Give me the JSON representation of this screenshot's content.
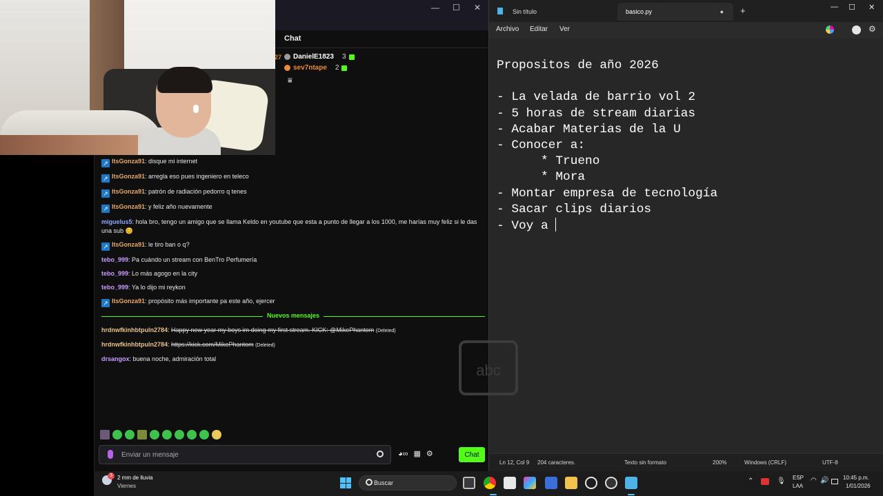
{
  "chat": {
    "title": "Chat",
    "leaderboard": [
      {
        "rank": "27",
        "user": "DanielE1823",
        "count": "3",
        "color": "#ffffff",
        "badge_color": "#9c9c9c"
      },
      {
        "rank": "",
        "user": "sev7ntape",
        "count": "2",
        "color": "#e88c3a",
        "badge_color": "#e88c3a"
      }
    ],
    "messages": [
      {
        "user": "ItsGonza91",
        "user_color": "#e8a86a",
        "kick_badge": true,
        "text": "disque mi internet"
      },
      {
        "user": "ItsGonza91",
        "user_color": "#e8a86a",
        "kick_badge": true,
        "text": "arregla eso pues ingeniero en teleco"
      },
      {
        "user": "ItsGonza91",
        "user_color": "#e8a86a",
        "kick_badge": true,
        "text": "patrón de radiación pedorro q tenes"
      },
      {
        "user": "ItsGonza91",
        "user_color": "#e8a86a",
        "kick_badge": true,
        "text": "y feliz año nuevamente"
      },
      {
        "user": "miguelus5",
        "user_color": "#8fa7ff",
        "kick_badge": false,
        "text": "hola bro, tengo un amigo que se llama Keldo en youtube que esta a punto de llegar a los 1000, me harías muy feliz si le das una sub 😊"
      },
      {
        "user": "ItsGonza91",
        "user_color": "#e8a86a",
        "kick_badge": true,
        "text": "le tiro ban o q?"
      },
      {
        "user": "tebo_999",
        "user_color": "#c89cff",
        "kick_badge": false,
        "text": "Pa cuándo un stream con BenTro Perfumería"
      },
      {
        "user": "tebo_999",
        "user_color": "#c89cff",
        "kick_badge": false,
        "text": "Lo más agogo en la city"
      },
      {
        "user": "tebo_999",
        "user_color": "#c89cff",
        "kick_badge": false,
        "text": "Ya lo dijo mi reykon"
      },
      {
        "user": "ItsGonza91",
        "user_color": "#e8a86a",
        "kick_badge": true,
        "text": "propósito más importante pa este año, ejercer"
      }
    ],
    "new_messages_label": "Nuevos mensajes",
    "new_messages": [
      {
        "user": "hrdnwfkinhbtpuln2784",
        "user_color": "#e8c08a",
        "text": "Happy new year my boys im doing my first stream. KICK: @MikePhantom",
        "deleted_label": "(Deleted)"
      },
      {
        "user": "hrdnwfkinhbtpuln2784",
        "user_color": "#e8c08a",
        "text": "https://kick.com/MikePhantom",
        "deleted_label": "(Deleted)"
      },
      {
        "user": "drsangox",
        "user_color": "#c89cff",
        "text": "buena noche, admiración total",
        "deleted_label": ""
      }
    ],
    "input_placeholder": "Enviar un mensaje",
    "send_label": "Chat",
    "window_controls": [
      "—",
      "☐",
      "✕"
    ]
  },
  "notepad": {
    "tabs": [
      "Sin título",
      "basico.py"
    ],
    "menu": [
      "Archivo",
      "Editar",
      "Ver"
    ],
    "lines": [
      "Propositos de año 2026",
      "",
      "- La velada de barrio vol 2",
      "- 5 horas de stream diarias",
      "- Acabar Materias de la U",
      "- Conocer a:",
      "      * Trueno",
      "      * Mora",
      "- Montar empresa de tecnología",
      "- Sacar clips diarios",
      "- Voy a "
    ],
    "status": {
      "position": "Ln 12, Col 9",
      "chars": "204 caracteres.",
      "format": "Texto sin formato",
      "zoom": "200%",
      "eol": "Windows (CRLF)",
      "encoding": "UTF-8"
    },
    "ghost_text": "abc"
  },
  "taskbar": {
    "weather_badge": "3",
    "weather_line1": "2 mm de lluvia",
    "weather_line2": "Viernes",
    "search_label": "Buscar",
    "lang1": "ESP",
    "lang2": "LAA",
    "time": "10:45 p.m.",
    "date": "1/01/2026"
  }
}
